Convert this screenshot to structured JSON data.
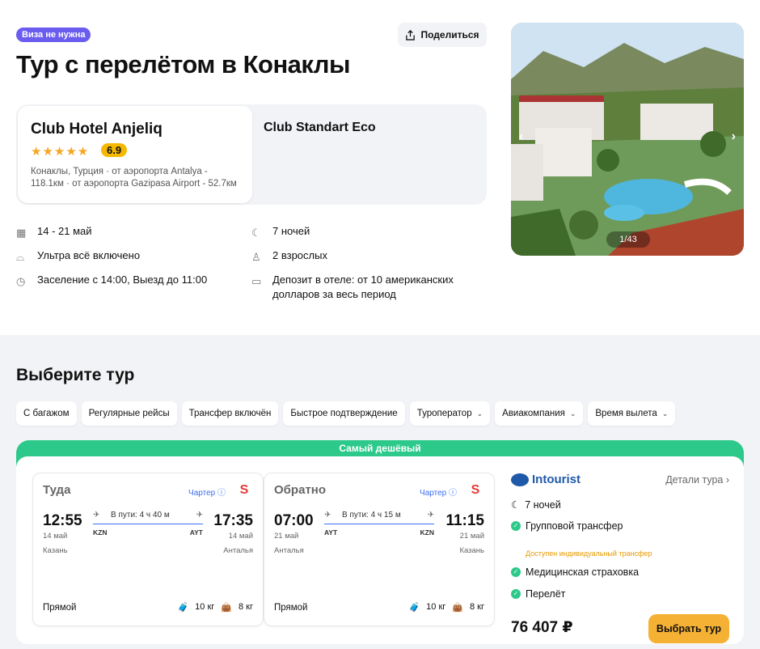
{
  "header": {
    "visa_badge": "Виза не нужна",
    "title": "Тур с перелётом в Конаклы",
    "share_label": "Поделиться"
  },
  "hotel": {
    "name": "Club Hotel Anjeliq",
    "stars": 5,
    "rating": "6.9",
    "location": "Конаклы, Турция · от аэропорта Antalya - 118.1км · от аэропорта Gazipasa Airport - 52.7км",
    "room": "Club Standart Eco"
  },
  "gallery": {
    "counter": "1/43"
  },
  "facts": {
    "dates": "14 - 21 май",
    "nights": "7 ночей",
    "meal": "Ультра всё включено",
    "guests": "2 взрослых",
    "checkin": "Заселение с 14:00, Выезд до 11:00",
    "deposit": "Депозит в отеле: от 10 американских долларов за весь период"
  },
  "choose": {
    "title": "Выберите тур",
    "filters": [
      "С багажом",
      "Регулярные рейсы",
      "Трансфер включён",
      "Быстрое подтверждение",
      "Туроператор",
      "Авиакомпания",
      "Время вылета"
    ]
  },
  "tour": {
    "label": "Самый дешёвый",
    "outbound": {
      "title": "Туда",
      "charter": "Чартер",
      "dep_time": "12:55",
      "arr_time": "17:35",
      "dep_date": "14 май",
      "arr_date": "14 май",
      "duration": "В пути: 4 ч 40 м",
      "dep_code": "KZN",
      "arr_code": "AYT",
      "dep_city": "Казань",
      "arr_city": "Анталья",
      "type": "Прямой",
      "luggage": "10 кг",
      "hand": "8 кг"
    },
    "return": {
      "title": "Обратно",
      "charter": "Чартер",
      "dep_time": "07:00",
      "arr_time": "11:15",
      "dep_date": "21 май",
      "arr_date": "21 май",
      "duration": "В пути: 4 ч 15 м",
      "dep_code": "AYT",
      "arr_code": "KZN",
      "dep_city": "Анталья",
      "arr_city": "Казань",
      "type": "Прямой",
      "luggage": "10 кг",
      "hand": "8 кг"
    },
    "operator": "Intourist",
    "details_link": "Детали тура",
    "nights": "7 ночей",
    "transfer": "Групповой трансфер",
    "transfer_note": "Доступен индивидуальный трансфер",
    "insurance": "Медицинская страховка",
    "flight": "Перелёт",
    "price": "76 407 ₽",
    "select_label": "Выбрать тур"
  },
  "colors": {
    "accent_green": "#2cc98a",
    "button_yellow": "#f5b133",
    "badge_purple": "#6b5cf0",
    "link_blue": "#3a6df0"
  }
}
